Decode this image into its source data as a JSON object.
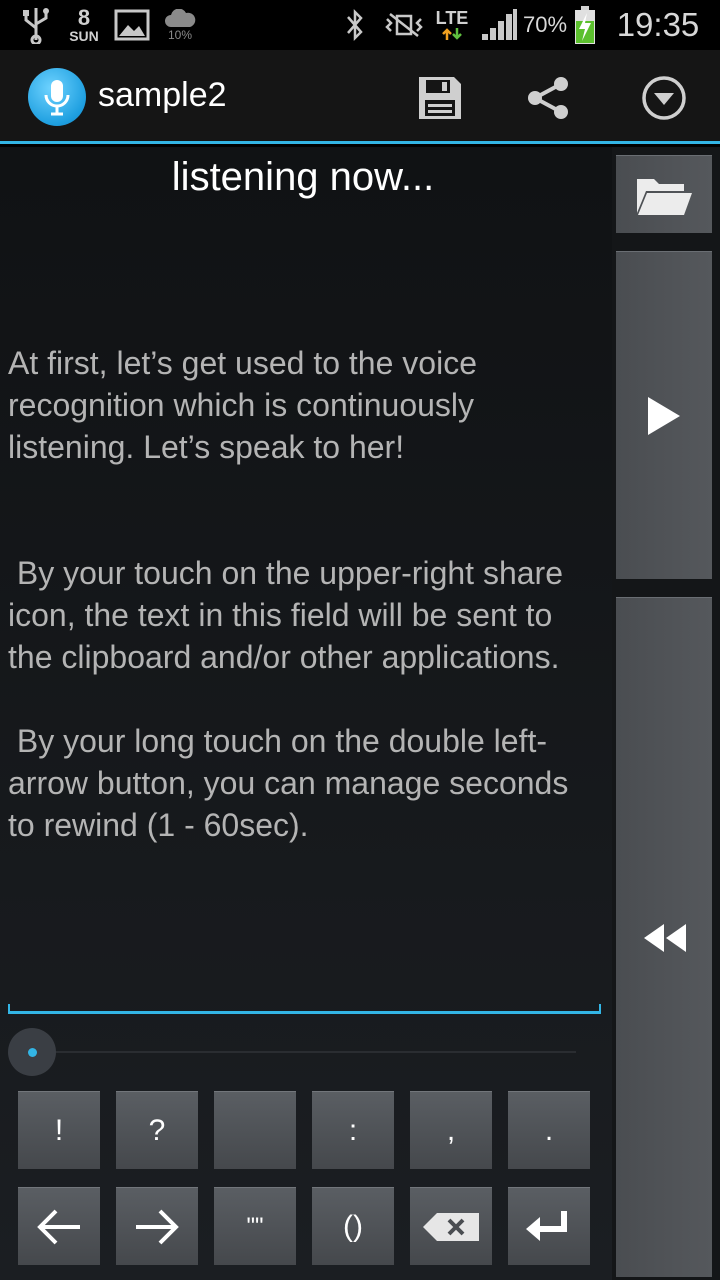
{
  "status_bar": {
    "day_number": "8",
    "day_name": "SUN",
    "weather_percent": "10%",
    "network": "LTE",
    "battery": "70%",
    "time": "19:35",
    "icons": [
      "usb-icon",
      "gallery-icon",
      "weather-icon",
      "bluetooth-icon",
      "vibrate-icon",
      "signal-icon",
      "battery-charging-icon"
    ]
  },
  "action_bar": {
    "title": "sample2",
    "actions": [
      "save-icon",
      "share-icon",
      "overflow-menu-icon"
    ]
  },
  "main": {
    "status_text": "listening now...",
    "paragraphs": [
      "At first, let’s get used to the voice recognition which is continuously listening. Let’s speak to her!",
      " By your touch on the upper-right share icon, the text in this field will be sent to the clipboard and/or other applications.",
      " By your long touch on the double left-arrow button, you can manage seconds to rewind (1 - 60sec)."
    ],
    "seek_progress": 0.0
  },
  "keypad": {
    "row1": [
      "!",
      "?",
      "",
      ":",
      ",",
      "."
    ],
    "row2": [
      "←",
      "→",
      "\"\"",
      "()",
      "backspace-icon",
      "enter-icon"
    ]
  },
  "side_panel": {
    "buttons": [
      "folder-icon",
      "play-icon",
      "rewind-icon"
    ]
  },
  "colors": {
    "accent": "#33b5e5",
    "text_body": "#b4b4b4",
    "background": "#101214"
  }
}
